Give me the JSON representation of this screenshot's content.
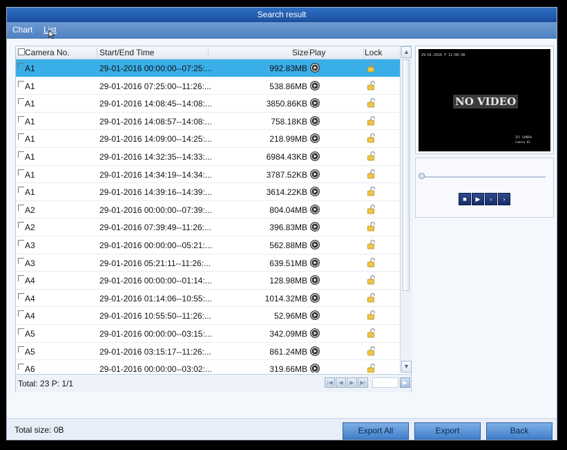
{
  "title": "Search result",
  "tabs": [
    {
      "label": "Chart"
    },
    {
      "label": "List"
    }
  ],
  "table": {
    "headers": {
      "camera": "Camera No.",
      "time": "Start/End Time",
      "size": "Size",
      "play": "Play",
      "lock": "Lock"
    },
    "rows": [
      {
        "camera": "A1",
        "time": "29-01-2016 00:00:00--07:25:...",
        "size": "992.83MB",
        "selected": true
      },
      {
        "camera": "A1",
        "time": "29-01-2016 07:25:00--11:26:...",
        "size": "538.86MB",
        "selected": false
      },
      {
        "camera": "A1",
        "time": "29-01-2016 14:08:45--14:08:...",
        "size": "3850.86KB",
        "selected": false
      },
      {
        "camera": "A1",
        "time": "29-01-2016 14:08:57--14:08:...",
        "size": "758.18KB",
        "selected": false
      },
      {
        "camera": "A1",
        "time": "29-01-2016 14:09:00--14:25:...",
        "size": "218.99MB",
        "selected": false
      },
      {
        "camera": "A1",
        "time": "29-01-2016 14:32:35--14:33:...",
        "size": "6984.43KB",
        "selected": false
      },
      {
        "camera": "A1",
        "time": "29-01-2016 14:34:19--14:34:...",
        "size": "3787.52KB",
        "selected": false
      },
      {
        "camera": "A1",
        "time": "29-01-2016 14:39:16--14:39:...",
        "size": "3614.22KB",
        "selected": false
      },
      {
        "camera": "A2",
        "time": "29-01-2016 00:00:00--07:39:...",
        "size": "804.04MB",
        "selected": false
      },
      {
        "camera": "A2",
        "time": "29-01-2016 07:39:49--11:26:...",
        "size": "396.83MB",
        "selected": false
      },
      {
        "camera": "A3",
        "time": "29-01-2016 00:00:00--05:21:...",
        "size": "562.88MB",
        "selected": false
      },
      {
        "camera": "A3",
        "time": "29-01-2016 05:21:11--11:26:...",
        "size": "639.51MB",
        "selected": false
      },
      {
        "camera": "A4",
        "time": "29-01-2016 00:00:00--01:14:...",
        "size": "128.98MB",
        "selected": false
      },
      {
        "camera": "A4",
        "time": "29-01-2016 01:14:06--10:55:...",
        "size": "1014.32MB",
        "selected": false
      },
      {
        "camera": "A4",
        "time": "29-01-2016 10:55:50--11:26:...",
        "size": "52.96MB",
        "selected": false
      },
      {
        "camera": "A5",
        "time": "29-01-2016 00:00:00--03:15:...",
        "size": "342.09MB",
        "selected": false
      },
      {
        "camera": "A5",
        "time": "29-01-2016 03:15:17--11:26:...",
        "size": "861.24MB",
        "selected": false
      },
      {
        "camera": "A6",
        "time": "29-01-2016 00:00:00--03:02:...",
        "size": "319.66MB",
        "selected": false
      }
    ]
  },
  "footer": {
    "total": "Total: 23  P: 1/1"
  },
  "preview": {
    "osd_top": "29-01-2016 F 11:08:38",
    "no_video": "NO VIDEO",
    "osd_bottom_1": "IP1 CAMERA",
    "osd_bottom_2": "Camera 01"
  },
  "bottom": {
    "total_size": "Total size: 0B",
    "buttons": {
      "export_all": "Export All",
      "export": "Export",
      "back": "Back"
    }
  },
  "colors": {
    "selected_row": "#3aaee8",
    "title_bar": "#1b4f9e",
    "button": "#3f7fcb"
  }
}
